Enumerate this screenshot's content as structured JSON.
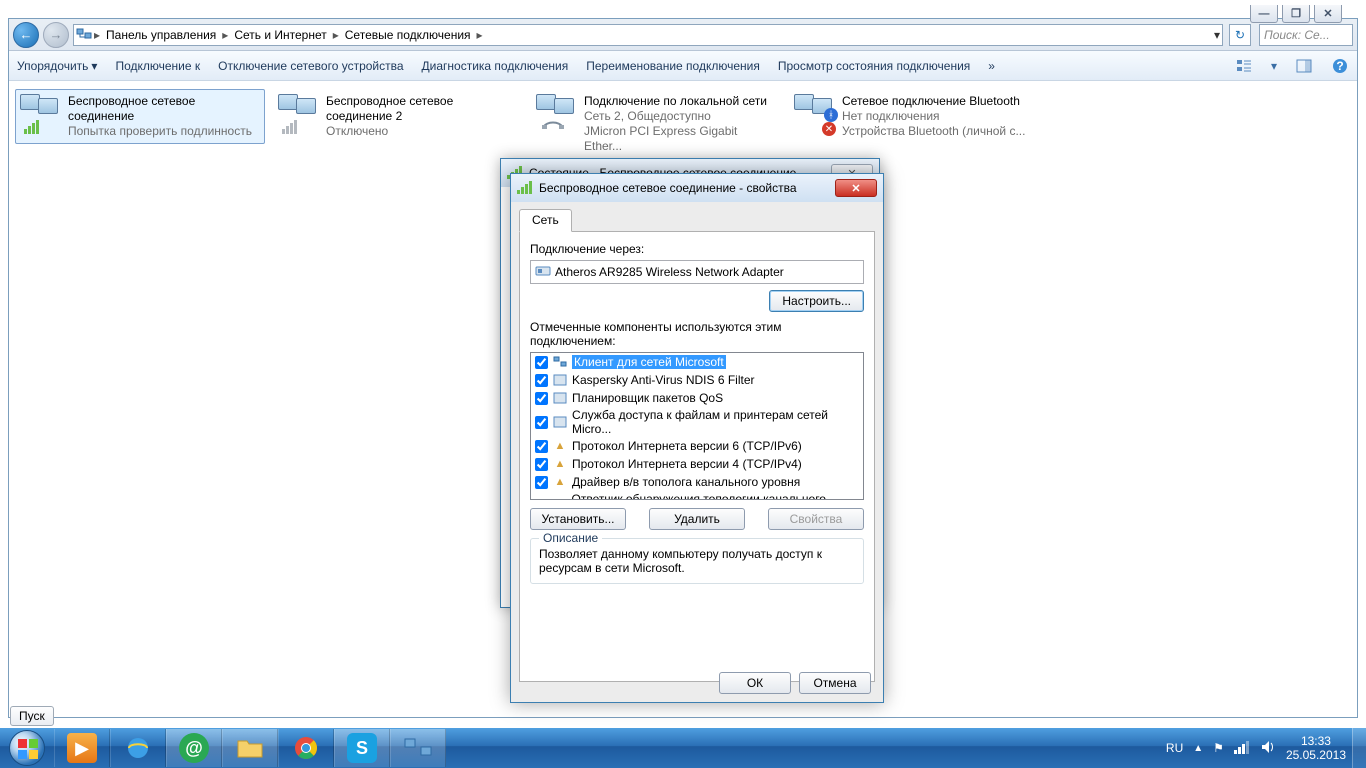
{
  "chrome": {
    "min": "—",
    "max": "❐",
    "close": "✕"
  },
  "breadcrumbs": {
    "b1": "Панель управления",
    "b2": "Сеть и Интернет",
    "b3": "Сетевые подключения"
  },
  "search": {
    "placeholder": "Поиск: Се..."
  },
  "toolbar": {
    "organize": "Упорядочить",
    "connect": "Подключение к",
    "disconnect": "Отключение сетевого устройства",
    "diagnose": "Диагностика подключения",
    "rename": "Переименование подключения",
    "status": "Просмотр состояния подключения",
    "more": "»"
  },
  "connections": [
    {
      "title": "Беспроводное сетевое соединение",
      "line2": "Попытка проверить подлинность",
      "line1b": ""
    },
    {
      "title": "Беспроводное сетевое соединение 2",
      "line2": "Отключено",
      "line1b": ""
    },
    {
      "title": "Подключение по локальной сети",
      "line1b": "Сеть 2, Общедоступно",
      "line2": "JMicron PCI Express Gigabit Ether..."
    },
    {
      "title": "Сетевое подключение Bluetooth",
      "line1b": "Нет подключения",
      "line2": "Устройства Bluetooth (личной с..."
    }
  ],
  "back_dialog": {
    "title": "Состояние - Беспроводное сетевое соединение"
  },
  "dialog": {
    "title": "Беспроводное сетевое соединение - свойства",
    "tab": "Сеть",
    "connect_via": "Подключение через:",
    "adapter": "Atheros AR9285 Wireless Network Adapter",
    "configure": "Настроить...",
    "components_label": "Отмеченные компоненты используются этим подключением:",
    "components": [
      "Клиент для сетей Microsoft",
      "Kaspersky Anti-Virus NDIS 6 Filter",
      "Планировщик пакетов QoS",
      "Служба доступа к файлам и принтерам сетей Micro...",
      "Протокол Интернета версии 6 (TCP/IPv6)",
      "Протокол Интернета версии 4 (TCP/IPv4)",
      "Драйвер в/в тополога канального уровня",
      "Ответчик обнаружения топологии канального уровня"
    ],
    "install": "Установить...",
    "uninstall": "Удалить",
    "properties": "Свойства",
    "desc_legend": "Описание",
    "desc_text": "Позволяет данному компьютеру получать доступ к ресурсам в сети Microsoft.",
    "ok": "ОК",
    "cancel": "Отмена"
  },
  "start_hint": "Пуск",
  "tray": {
    "lang": "RU",
    "time": "13:33",
    "date": "25.05.2013"
  }
}
